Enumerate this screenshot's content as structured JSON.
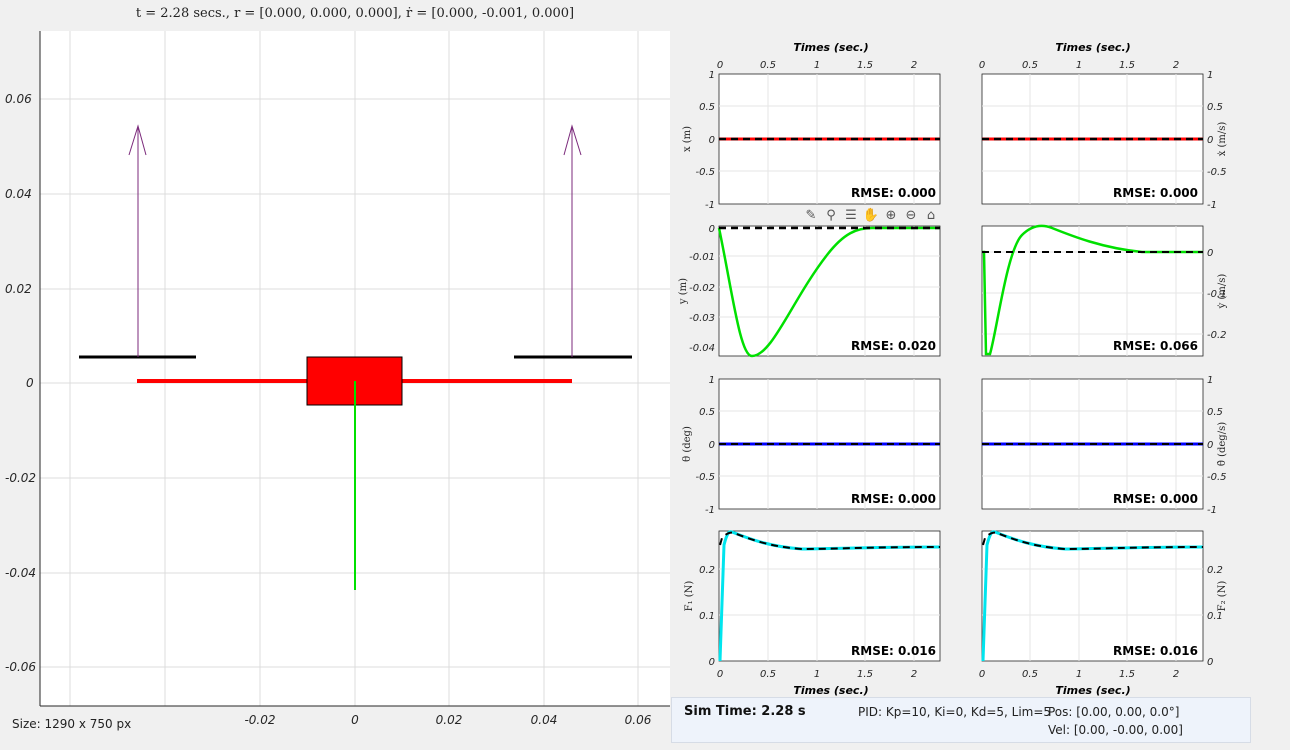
{
  "title": "t = 2.28 secs., r = [0.000, 0.000, 0.000], ṙ = [0.000, -0.001, 0.000]",
  "size_label": "Size: 1290 x 750 px",
  "main_axes": {
    "x_ticks": [
      "-0.02",
      "0",
      "0.02",
      "0.04",
      "0.06"
    ],
    "y_ticks": [
      "0.06",
      "0.04",
      "0.02",
      "0",
      "-0.02",
      "-0.04",
      "-0.06"
    ]
  },
  "time_ticks": [
    "0",
    "0.5",
    "1",
    "1.5",
    "2"
  ],
  "xlabel": "Times (sec.)",
  "panels": [
    {
      "ylabel": "x (m)",
      "rmse": "RMSE: 0.000",
      "yticks": [
        "1",
        "0.5",
        "0",
        "-0.5",
        "-1"
      ]
    },
    {
      "ylabel": "ẋ (m/s)",
      "rmse": "RMSE: 0.000",
      "yticks": [
        "1",
        "0.5",
        "0",
        "-0.5",
        "-1"
      ]
    },
    {
      "ylabel": "y (m)",
      "rmse": "RMSE: 0.020",
      "yticks": [
        "0",
        "-0.01",
        "-0.02",
        "-0.03",
        "-0.04"
      ]
    },
    {
      "ylabel": "ẏ (m/s)",
      "rmse": "RMSE: 0.066",
      "yticks": [
        "0",
        "-0.1",
        "-0.2"
      ]
    },
    {
      "ylabel": "θ (deg)",
      "rmse": "RMSE: 0.000",
      "yticks": [
        "1",
        "0.5",
        "0",
        "-0.5",
        "-1"
      ]
    },
    {
      "ylabel": "θ̇ (deg/s)",
      "rmse": "RMSE: 0.000",
      "yticks": [
        "1",
        "0.5",
        "0",
        "-0.5",
        "-1"
      ]
    },
    {
      "ylabel": "F₁ (N)",
      "rmse": "RMSE: 0.016",
      "yticks": [
        "0.2",
        "0.1",
        "0"
      ]
    },
    {
      "ylabel": "F₂ (N)",
      "rmse": "RMSE: 0.016",
      "yticks": [
        "0.2",
        "0.1",
        "0"
      ]
    }
  ],
  "status": {
    "sim_time": "Sim Time: 2.28 s",
    "pid": "PID: Kp=10, Ki=0, Kd=5, Lim=5",
    "pos": "Pos: [0.00, 0.00, 0.0°]",
    "vel": "Vel: [0.00, -0.00, 0.00]"
  },
  "colors": {
    "body": "#ff0000",
    "arm": "#ff0000",
    "thrust": "#7b2a7b",
    "green": "#00e000",
    "blue": "#0000ff",
    "cyan": "#00e5ee"
  },
  "toolbar_icons": [
    "brush-icon",
    "data-tips-icon",
    "legend-icon",
    "pan-icon",
    "zoom-in-icon",
    "zoom-out-icon",
    "home-icon"
  ]
}
